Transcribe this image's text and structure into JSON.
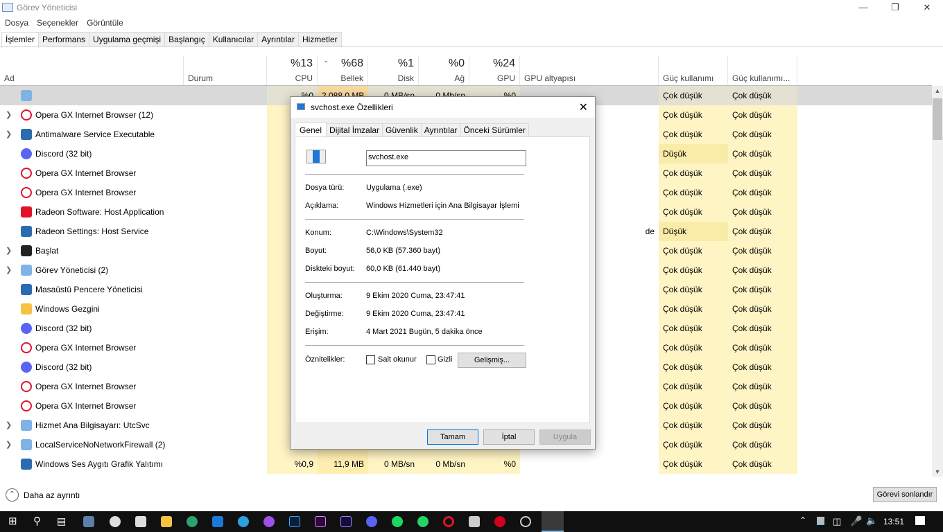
{
  "window": {
    "title": "Görev Yöneticisi"
  },
  "menu": [
    "Dosya",
    "Seçenekler",
    "Görüntüle"
  ],
  "tabs": [
    "İşlemler",
    "Performans",
    "Uygulama geçmişi",
    "Başlangıç",
    "Kullanıcılar",
    "Ayrıntılar",
    "Hizmetler"
  ],
  "columns": {
    "name": "Ad",
    "status": "Durum",
    "cpu_pct": "%13",
    "cpu": "CPU",
    "mem_pct": "%68",
    "mem": "Bellek",
    "disk_pct": "%1",
    "disk": "Disk",
    "net_pct": "%0",
    "net": "Ağ",
    "gpu_pct": "%24",
    "gpu": "GPU",
    "gpu_engine": "GPU altyapısı",
    "power": "Güç kullanımı",
    "power_trend": "Güç kullanımı..."
  },
  "rows": [
    {
      "name": "",
      "cpu": "%0",
      "mem": "2.088,0 MB",
      "disk": "0 MB/sn",
      "net": "0 Mb/sn",
      "gpu": "%0",
      "power": "Çok düşük",
      "power_trend": "Çok düşük"
    },
    {
      "name": "Opera GX Internet Browser (12)",
      "power": "Çok düşük",
      "power_trend": "Çok düşük"
    },
    {
      "name": "Antimalware Service Executable",
      "power": "Çok düşük",
      "power_trend": "Çok düşük"
    },
    {
      "name": "Discord (32 bit)",
      "power": "Düşük",
      "power_trend": "Çok düşük"
    },
    {
      "name": "Opera GX Internet Browser",
      "power": "Çok düşük",
      "power_trend": "Çok düşük"
    },
    {
      "name": "Opera GX Internet Browser",
      "power": "Çok düşük",
      "power_trend": "Çok düşük"
    },
    {
      "name": "Radeon Software: Host Application",
      "power": "Çok düşük",
      "power_trend": "Çok düşük"
    },
    {
      "name": "Radeon Settings: Host Service",
      "gpu_engine": "de",
      "power": "Düşük",
      "power_trend": "Çok düşük"
    },
    {
      "name": "Başlat",
      "power": "Çok düşük",
      "power_trend": "Çok düşük"
    },
    {
      "name": "Görev Yöneticisi (2)",
      "power": "Çok düşük",
      "power_trend": "Çok düşük"
    },
    {
      "name": "Masaüstü Pencere Yöneticisi",
      "power": "Çok düşük",
      "power_trend": "Çok düşük"
    },
    {
      "name": "Windows Gezgini",
      "power": "Çok düşük",
      "power_trend": "Çok düşük"
    },
    {
      "name": "Discord (32 bit)",
      "power": "Çok düşük",
      "power_trend": "Çok düşük"
    },
    {
      "name": "Opera GX Internet Browser",
      "power": "Çok düşük",
      "power_trend": "Çok düşük"
    },
    {
      "name": "Discord (32 bit)",
      "power": "Çok düşük",
      "power_trend": "Çok düşük"
    },
    {
      "name": "Opera GX Internet Browser",
      "power": "Çok düşük",
      "power_trend": "Çok düşük"
    },
    {
      "name": "Opera GX Internet Browser",
      "power": "Çok düşük",
      "power_trend": "Çok düşük"
    },
    {
      "name": "Hizmet Ana Bilgisayarı: UtcSvc",
      "power": "Çok düşük",
      "power_trend": "Çok düşük"
    },
    {
      "name": "LocalServiceNoNetworkFirewall (2)",
      "power": "Çok düşük",
      "power_trend": "Çok düşük"
    },
    {
      "name": "Windows Ses Aygıtı Grafik Yalıtımı",
      "cpu": "%0,9",
      "mem": "11,9 MB",
      "disk": "0 MB/sn",
      "net": "0 Mb/sn",
      "gpu": "%0",
      "power": "Çok düşük",
      "power_trend": "Çok düşük"
    }
  ],
  "footer": {
    "less_details": "Daha az ayrıntı",
    "end_task": "Görevi sonlandır"
  },
  "dialog": {
    "title": "svchost.exe Özellikleri",
    "tabs": [
      "Genel",
      "Dijital İmzalar",
      "Güvenlik",
      "Ayrıntılar",
      "Önceki Sürümler"
    ],
    "filename": "svchost.exe",
    "fields": [
      {
        "label": "Dosya türü:",
        "value": "Uygulama (.exe)"
      },
      {
        "label": "Açıklama:",
        "value": "Windows Hizmetleri için Ana Bilgisayar İşlemi"
      },
      {
        "label": "Konum:",
        "value": "C:\\Windows\\System32"
      },
      {
        "label": "Boyut:",
        "value": "56,0 KB (57.360 bayt)"
      },
      {
        "label": "Diskteki boyut:",
        "value": "60,0 KB (61.440 bayt)"
      },
      {
        "label": "Oluşturma:",
        "value": "9 Ekim 2020 Cuma, 23:47:41"
      },
      {
        "label": "Değiştirme:",
        "value": "9 Ekim 2020 Cuma, 23:47:41"
      },
      {
        "label": "Erişim:",
        "value": "4 Mart 2021 Bugün, 5 dakika önce"
      }
    ],
    "attributes_label": "Öznitelikler:",
    "readonly": "Salt okunur",
    "hidden": "Gizli",
    "advanced": "Gelişmiş...",
    "ok": "Tamam",
    "cancel": "İptal",
    "apply": "Uygula"
  },
  "taskbar": {
    "time": "13:51"
  }
}
